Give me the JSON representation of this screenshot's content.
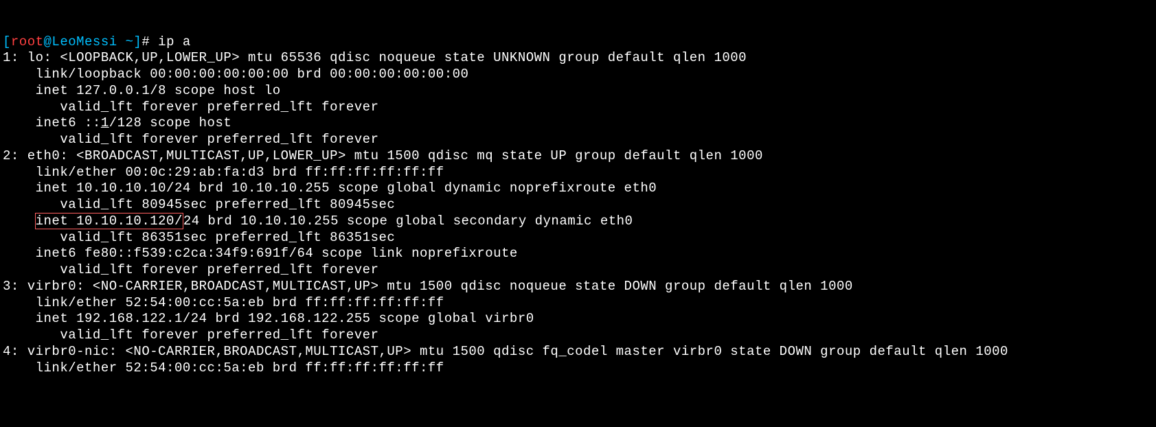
{
  "prompt": {
    "lbracket": "[",
    "user": "root",
    "at": "@",
    "host": "LeoMessi",
    "path": " ~",
    "rbracket": "]",
    "hash": "# ",
    "command": "ip a"
  },
  "lines": {
    "l1": "1: lo: <LOOPBACK,UP,LOWER_UP> mtu 65536 qdisc noqueue state UNKNOWN group default qlen 1000",
    "l2": "    link/loopback 00:00:00:00:00:00 brd 00:00:00:00:00:00",
    "l3": "    inet 127.0.0.1/8 scope host lo",
    "l4": "       valid_lft forever preferred_lft forever",
    "l5a": "    inet6 ::",
    "l5b": "1",
    "l5c": "/128 scope host ",
    "l6": "       valid_lft forever preferred_lft forever",
    "l7": "2: eth0: <BROADCAST,MULTICAST,UP,LOWER_UP> mtu 1500 qdisc mq state UP group default qlen 1000",
    "l8": "    link/ether 00:0c:29:ab:fa:d3 brd ff:ff:ff:ff:ff:ff",
    "l9": "    inet 10.10.10.10/24 brd 10.10.10.255 scope global dynamic noprefixroute eth0",
    "l10": "       valid_lft 80945sec preferred_lft 80945sec",
    "l11pre": "    ",
    "l11box": "inet 10.10.10.120/",
    "l11post": "24 brd 10.10.10.255 scope global secondary dynamic eth0",
    "l12": "       valid_lft 86351sec preferred_lft 86351sec",
    "l13": "    inet6 fe80::f539:c2ca:34f9:691f/64 scope link noprefixroute ",
    "l14": "       valid_lft forever preferred_lft forever",
    "l15": "3: virbr0: <NO-CARRIER,BROADCAST,MULTICAST,UP> mtu 1500 qdisc noqueue state DOWN group default qlen 1000",
    "l16": "    link/ether 52:54:00:cc:5a:eb brd ff:ff:ff:ff:ff:ff",
    "l17": "    inet 192.168.122.1/24 brd 192.168.122.255 scope global virbr0",
    "l18": "       valid_lft forever preferred_lft forever",
    "l19": "4: virbr0-nic: <NO-CARRIER,BROADCAST,MULTICAST,UP> mtu 1500 qdisc fq_codel master virbr0 state DOWN group default qlen 1000",
    "l20": "    link/ether 52:54:00:cc:5a:eb brd ff:ff:ff:ff:ff:ff"
  }
}
